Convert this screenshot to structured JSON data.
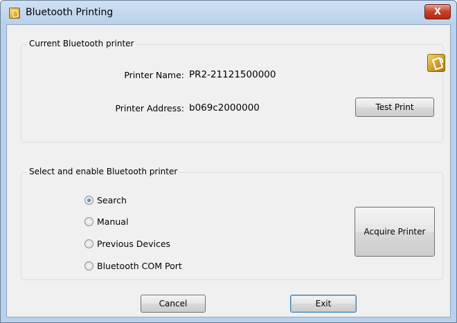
{
  "window": {
    "title": "Bluetooth Printing",
    "close_label": "X"
  },
  "current_group": {
    "label": "Current Bluetooth printer",
    "printer_name_label": "Printer Name:",
    "printer_name_value": "PR2-21121500000",
    "printer_address_label": "Printer Address:",
    "printer_address_value": "b069c2000000",
    "test_print_label": "Test Print",
    "icon": "bluetooth-printer-icon"
  },
  "select_group": {
    "label": "Select and enable Bluetooth printer",
    "options": [
      {
        "label": "Search",
        "checked": true
      },
      {
        "label": "Manual",
        "checked": false
      },
      {
        "label": "Previous Devices",
        "checked": false
      },
      {
        "label": "Bluetooth COM Port",
        "checked": false
      }
    ],
    "acquire_label": "Acquire Printer"
  },
  "footer": {
    "cancel_label": "Cancel",
    "exit_label": "Exit"
  }
}
